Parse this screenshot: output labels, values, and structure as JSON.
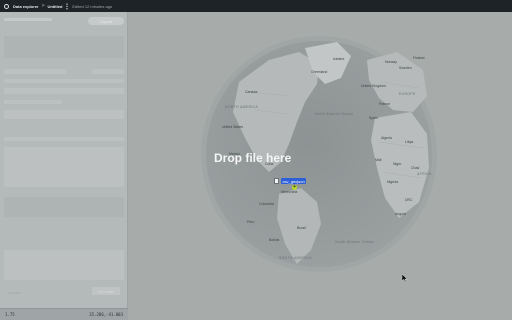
{
  "topbar": {
    "app_name": "Data explorer",
    "separator": ">",
    "document_title": "Untitled",
    "edited_text": "Edited 12 minutes ago"
  },
  "sidebar": {
    "top_button_label": "Layout",
    "footer_label": "Layout",
    "footer_button_label": "Add layer"
  },
  "statusbar": {
    "zoom": "1.75",
    "coordinates": "35.286,-41.003"
  },
  "map": {
    "labels": {
      "greenland": "Greenland",
      "north_america": "NORTH AMERICA",
      "canada": "Canada",
      "united_states": "United States",
      "mexico": "Mexico",
      "cuba": "Cuba",
      "venezuela": "Venezuela",
      "colombia": "Colombia",
      "peru": "Peru",
      "brazil": "Brazil",
      "bolivia": "Bolivia",
      "south_america": "SOUTH AMERICA",
      "iceland": "Iceland",
      "europe": "EUROPE",
      "norway": "Norway",
      "sweden": "Sweden",
      "finland": "Finland",
      "united_kingdom": "United Kingdom",
      "france": "France",
      "spain": "Spain",
      "algeria": "Algeria",
      "libya": "Libya",
      "mali": "Mali",
      "niger": "Niger",
      "chad": "Chad",
      "africa": "AFRICA",
      "nigeria": "Nigeria",
      "drc": "DRC",
      "angola": "Angola",
      "atlantic": "North Atlantic Ocean",
      "south_atlantic": "South Atlantic Ocean"
    }
  },
  "drop_overlay": {
    "message": "Drop file here",
    "file_name": "csv_geojson",
    "copy_badge": "+"
  },
  "colors": {
    "topbar_bg": "#1d2326",
    "drag_highlight": "#2d5fd6",
    "copy_badge": "#b7dc2a"
  }
}
